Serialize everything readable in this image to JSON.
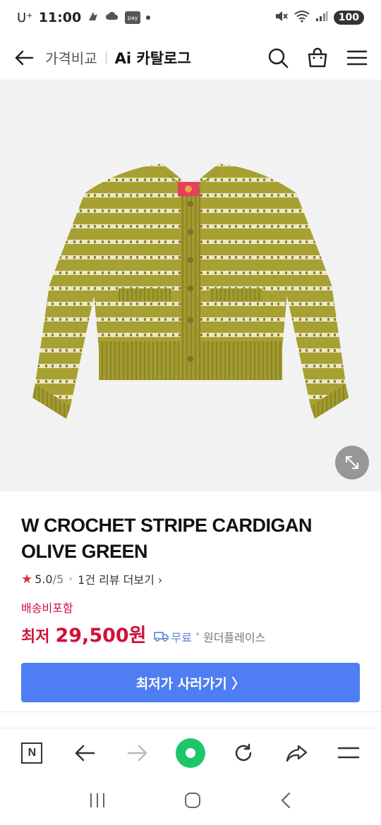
{
  "status_bar": {
    "carrier": "U⁺",
    "time": "11:00",
    "pay_icon": "pay",
    "battery": "100"
  },
  "header": {
    "crumb": "가격비교",
    "title": "Ai 카탈로그"
  },
  "product": {
    "title": "W CROCHET STRIPE CARDIGAN OLIVE GREEN",
    "rating": "5.0",
    "rating_max": "/5",
    "reviews_link": "1건 리뷰 더보기",
    "shipping_label": "배송비포함",
    "price_prefix": "최저",
    "price": "29,500원",
    "shipping_fee": "무료",
    "seller": "원더플레이스",
    "cta_label": "최저가 사러가기 〉"
  },
  "colors": {
    "accent": "#4f7df3",
    "price_red": "#d0103a",
    "knit_olive": "#a7a032",
    "green_button": "#1ec56b"
  },
  "icons": {
    "header": [
      "back-arrow-icon",
      "search-icon",
      "shopping-bag-icon",
      "menu-icon"
    ],
    "toolbar": [
      "naver-n-icon",
      "back-icon",
      "forward-icon",
      "green-home-icon",
      "refresh-icon",
      "share-icon",
      "menu-icon"
    ],
    "nav": [
      "recent-apps-icon",
      "home-icon",
      "back-icon"
    ]
  }
}
